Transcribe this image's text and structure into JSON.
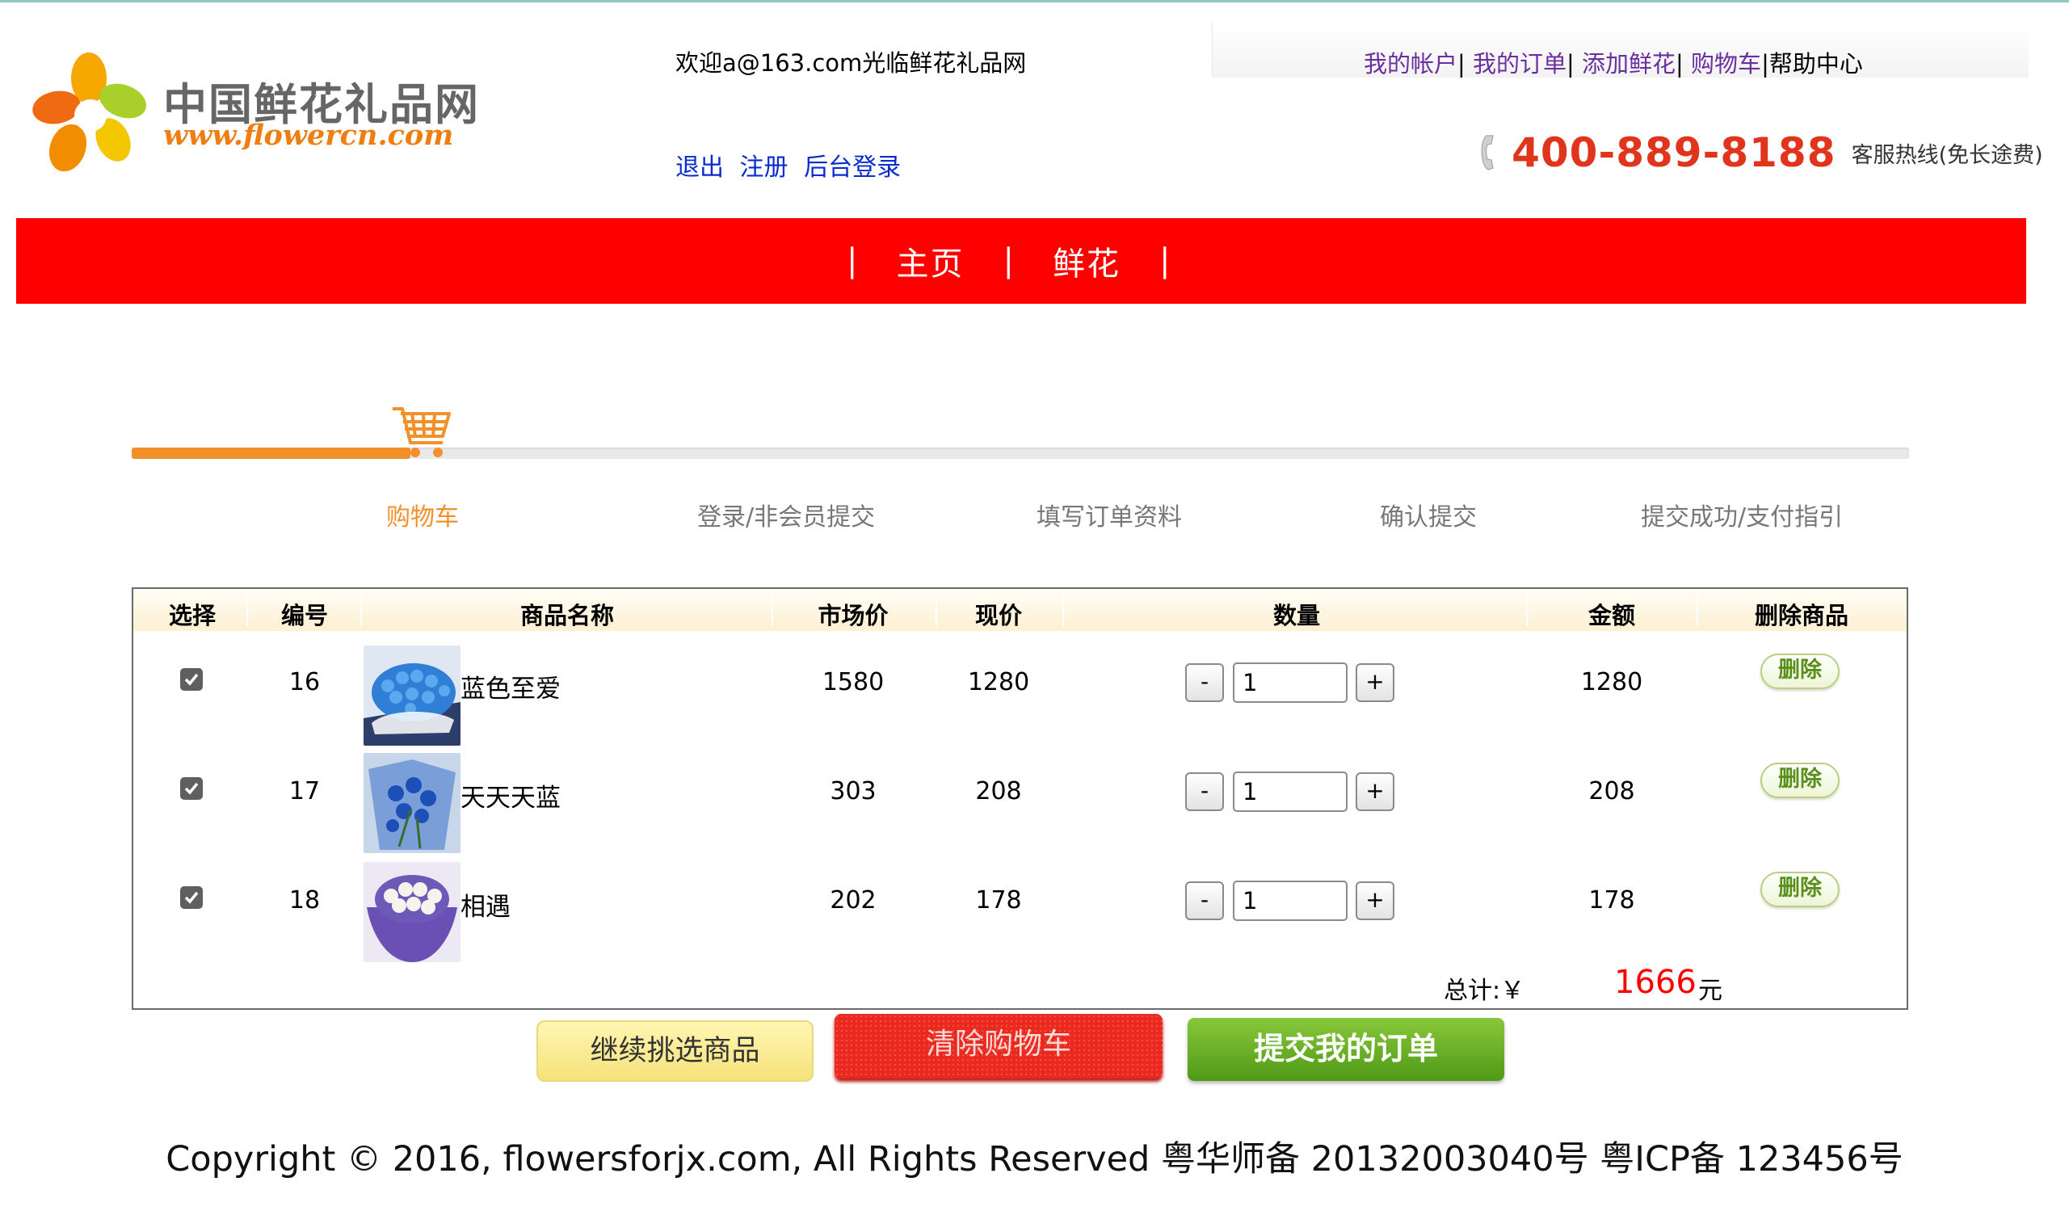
{
  "header": {
    "logo": {
      "cn": "中国鲜花礼品网",
      "en": "www.flowercn.com"
    },
    "welcome": "欢迎a@163.com光临鲜花礼品网",
    "auth_links": [
      "退出",
      "注册",
      "后台登录"
    ],
    "top_links": [
      "我的帐户",
      "我的订单",
      "添加鲜花",
      "购物车",
      "帮助中心"
    ],
    "hotline_number": "400-889-8188",
    "hotline_desc": "客服热线(免长途费)"
  },
  "nav": {
    "items": [
      "主页",
      "鲜花"
    ],
    "separator": "|"
  },
  "progress": {
    "steps": [
      "购物车",
      "登录/非会员提交",
      "填写订单资料",
      "确认提交",
      "提交成功/支付指引"
    ],
    "active_step": 0,
    "active_color": "#f2912a"
  },
  "cart": {
    "headers": [
      "选择",
      "编号",
      "商品名称",
      "市场价",
      "现价",
      "数量",
      "金额",
      "删除商品"
    ],
    "rows": [
      {
        "checked": true,
        "id": "16",
        "name": "蓝色至爱",
        "market_price": "1580",
        "price": "1280",
        "qty": "1",
        "amount": "1280",
        "delete_label": "删除",
        "minus": "-",
        "plus": "+"
      },
      {
        "checked": true,
        "id": "17",
        "name": "天天天蓝",
        "market_price": "303",
        "price": "208",
        "qty": "1",
        "amount": "208",
        "delete_label": "删除",
        "minus": "-",
        "plus": "+"
      },
      {
        "checked": true,
        "id": "18",
        "name": "相遇",
        "market_price": "202",
        "price": "178",
        "qty": "1",
        "amount": "178",
        "delete_label": "删除",
        "minus": "-",
        "plus": "+"
      }
    ],
    "total_label": "总计:￥",
    "total_value": "1666",
    "total_unit": "元"
  },
  "actions": {
    "continue_label": "继续挑选商品",
    "clear_label": "清除购物车",
    "submit_label": "提交我的订单"
  },
  "footer": "Copyright © 2016, flowersforjx.com, All Rights Reserved 粤华师备 20132003040号 粤ICP备 123456号",
  "colors": {
    "nav_bg": "#ff0000",
    "total": "#ff0000",
    "hotline": "#e0341c",
    "link": "#0a2bd1",
    "top_link": "#6a2fa0"
  }
}
